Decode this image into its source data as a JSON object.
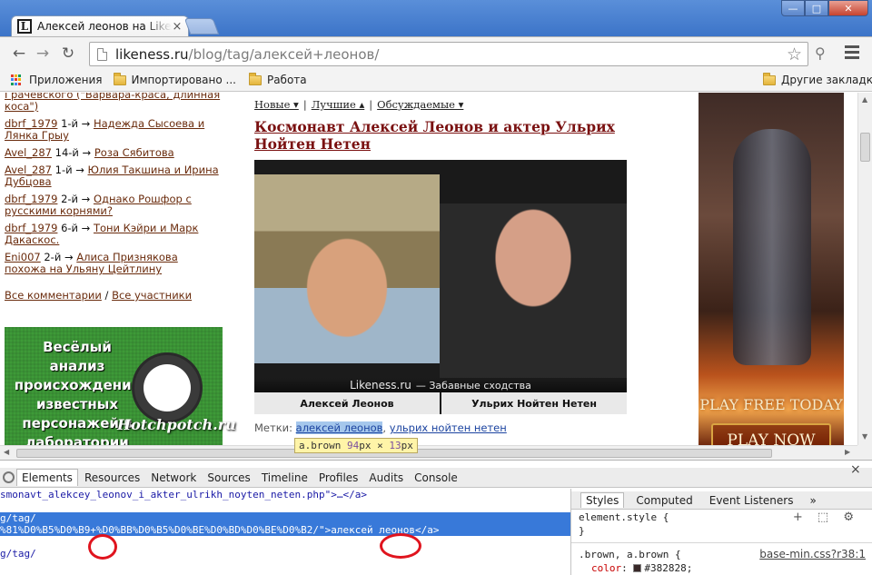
{
  "browser": {
    "tab_title": "Алексей леонов на Likeness.ru",
    "tab_favicon_letter": "L",
    "tab_close": "×",
    "url_host": "likeness.ru",
    "url_path": "/blog/tag/алексей+леонов/",
    "win_min": "—",
    "win_max": "□",
    "win_close": "✕"
  },
  "bookmarks": {
    "apps": "Приложения",
    "imported": "Импортировано ...",
    "work": "Работа",
    "other": "Другие закладки"
  },
  "left_column": {
    "top_line_1": "Грачевского (\"Варвара-краса, длинная",
    "top_line_2": "коса\")",
    "comments": [
      {
        "user": "dbrf_1979",
        "num": "1-й →",
        "link": "Надежда Сысоева и Лянка Грыу"
      },
      {
        "user": "Avel_287",
        "num": "14-й →",
        "link": "Роза Сябитова"
      },
      {
        "user": "Avel_287",
        "num": "1-й →",
        "link": "Юлия Такшина и Ирина Дубцова"
      },
      {
        "user": "dbrf_1979",
        "num": "2-й →",
        "link": "Однако Рошфор с русскими корнями?"
      },
      {
        "user": "dbrf_1979",
        "num": "6-й →",
        "link": "Тони Кэйри и Марк Дакаскос."
      },
      {
        "user": "Eni007",
        "num": "2-й →",
        "link": "Алиса Признякова похожа на Ульяну Цейтлину"
      }
    ],
    "all_comments": "Все комментарии",
    "separator": "/",
    "all_members": "Все участники",
    "promo_text": "Весёлый анализ происхождения известных персонажей в лаборатории",
    "promo_brand": "Hotchpotch.ru"
  },
  "main": {
    "sort_new": "Новые ▾",
    "sort_best": "Лучшие ▴",
    "sort_discussed": "Обсуждаемые ▾",
    "sep": "|",
    "post_title": "Космонавт Алексей Леонов и актер Ульрих Нойтен Нетен",
    "watermark_brand": "Likeness.ru",
    "watermark_tagline": "— Забавные сходства",
    "caption_left": "Алексей Леонов",
    "caption_right": "Ульрих Нойтен Нетен",
    "tags_label": "Метки:",
    "tag_1": "алексей леонов",
    "tag_comma": ",",
    "tag_2": "ульрих нойтен нетен"
  },
  "ad": {
    "headline": "PLAY FREE TODAY",
    "button": "PLAY NOW"
  },
  "tooltip": {
    "selector": "a.brown",
    "width": "94",
    "unit_w": "px",
    "times": "×",
    "height": "13",
    "unit_h": "px"
  },
  "devtools": {
    "tabs": [
      "Elements",
      "Resources",
      "Network",
      "Sources",
      "Timeline",
      "Profiles",
      "Audits",
      "Console"
    ],
    "close": "×",
    "code_lines": [
      "smonavt_alekcey_leonov_i_akter_ulrikh_noyten_neten.php\">…</a>",
      "",
      "g/tag/",
      "%81%D0%B5%D0%B9+%D0%BB%D0%B5%D0%BE%D0%BD%D0%BE%D0%B2/\">алексей леонов</a>",
      "",
      "g/tag/"
    ],
    "styles_tabs": [
      "Styles",
      "Computed",
      "Event Listeners"
    ],
    "styles_more": "»",
    "element_style": "element.style {",
    "close_brace": "}",
    "rule_selector": ".brown, a.brown {",
    "rule_source": "base-min.css?r38:1",
    "rule_prop": "color",
    "rule_value": "#382828;",
    "rule_color": "#382828",
    "tools": "+ ⬚ ⚙"
  }
}
